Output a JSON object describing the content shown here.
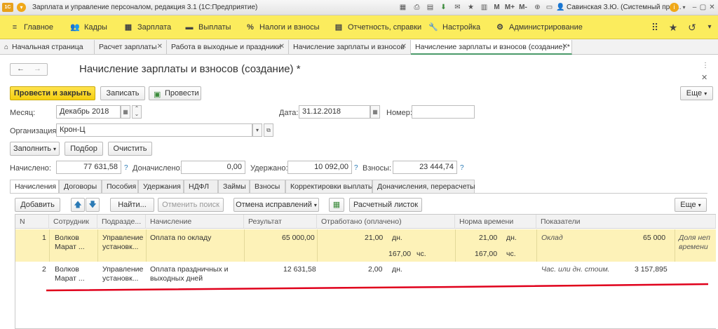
{
  "titlebar": {
    "app_title": "Зарплата и управление персоналом, редакция 3.1  (1С:Предприятие)",
    "user": "Савинская З.Ю. (Системный прог...",
    "m_buttons": [
      "M",
      "M+",
      "M-"
    ]
  },
  "sections": [
    "Главное",
    "Кадры",
    "Зарплата",
    "Выплаты",
    "Налоги и взносы",
    "Отчетность, справки",
    "Настройка",
    "Администрирование"
  ],
  "open_tabs": [
    "Начальная страница",
    "Расчет зарплаты",
    "Работа в выходные и праздники",
    "Начисление зарплаты и взносов",
    "Начисление зарплаты и взносов (создание) *"
  ],
  "form": {
    "title": "Начисление зарплаты и взносов (создание) *",
    "post_close": "Провести и закрыть",
    "save": "Записать",
    "post": "Провести",
    "more": "Еще",
    "month_label": "Месяц:",
    "month_value": "Декабрь 2018",
    "date_label": "Дата:",
    "date_value": "31.12.2018",
    "number_label": "Номер:",
    "number_value": "",
    "org_label": "Организация:",
    "org_value": "Крон-Ц",
    "fill": "Заполнить",
    "select": "Подбор",
    "clear": "Очистить",
    "accrued_label": "Начислено:",
    "accrued_value": "77 631,58",
    "additional_label": "Доначислено:",
    "additional_value": "0,00",
    "withheld_label": "Удержано:",
    "withheld_value": "10 092,00",
    "contrib_label": "Взносы:",
    "contrib_value": "23 444,74",
    "help": "?"
  },
  "form_tabs": [
    "Начисления",
    "Договоры",
    "Пособия",
    "Удержания",
    "НДФЛ",
    "Займы",
    "Взносы",
    "Корректировки выплаты",
    "Доначисления, перерасчеты"
  ],
  "table_toolbar": {
    "add": "Добавить",
    "find": "Найти...",
    "cancel_search": "Отменить поиск",
    "cancel_corrections": "Отмена исправлений",
    "payslip": "Расчетный листок",
    "more": "Еще"
  },
  "columns": [
    "N",
    "Сотрудник",
    "Подразде...",
    "Начисление",
    "Результат",
    "Отработано (оплачено)",
    "Норма времени",
    "Показатели"
  ],
  "rows": [
    {
      "n": "1",
      "employee": [
        "Волков",
        "Марат ..."
      ],
      "dept": [
        "Управление",
        "установк..."
      ],
      "accrual": [
        "Оплата по окладу"
      ],
      "result": "65 000,00",
      "worked_days": "21,00",
      "worked_days_unit": "дн.",
      "worked_hours": "167,00",
      "worked_hours_unit": "чс.",
      "norm_days": "21,00",
      "norm_days_unit": "дн.",
      "norm_hours": "167,00",
      "norm_hours_unit": "чс.",
      "indicator": "Оклад",
      "indicator_value": "65 000",
      "extra": [
        "Доля неп",
        "времени"
      ]
    },
    {
      "n": "2",
      "employee": [
        "Волков",
        "Марат ..."
      ],
      "dept": [
        "Управление",
        "установк..."
      ],
      "accrual": [
        "Оплата праздничных и",
        "выходных дней"
      ],
      "result": "12 631,58",
      "worked_days": "2,00",
      "worked_days_unit": "дн.",
      "indicator": "Час. или дн. стоим.",
      "indicator_value": "3 157,895"
    }
  ],
  "colors": {
    "section_bar": "#fbec5d",
    "primary_button": "#f5cf10",
    "selected_row": "#fdf2b8",
    "annotation": "#e0001b"
  }
}
